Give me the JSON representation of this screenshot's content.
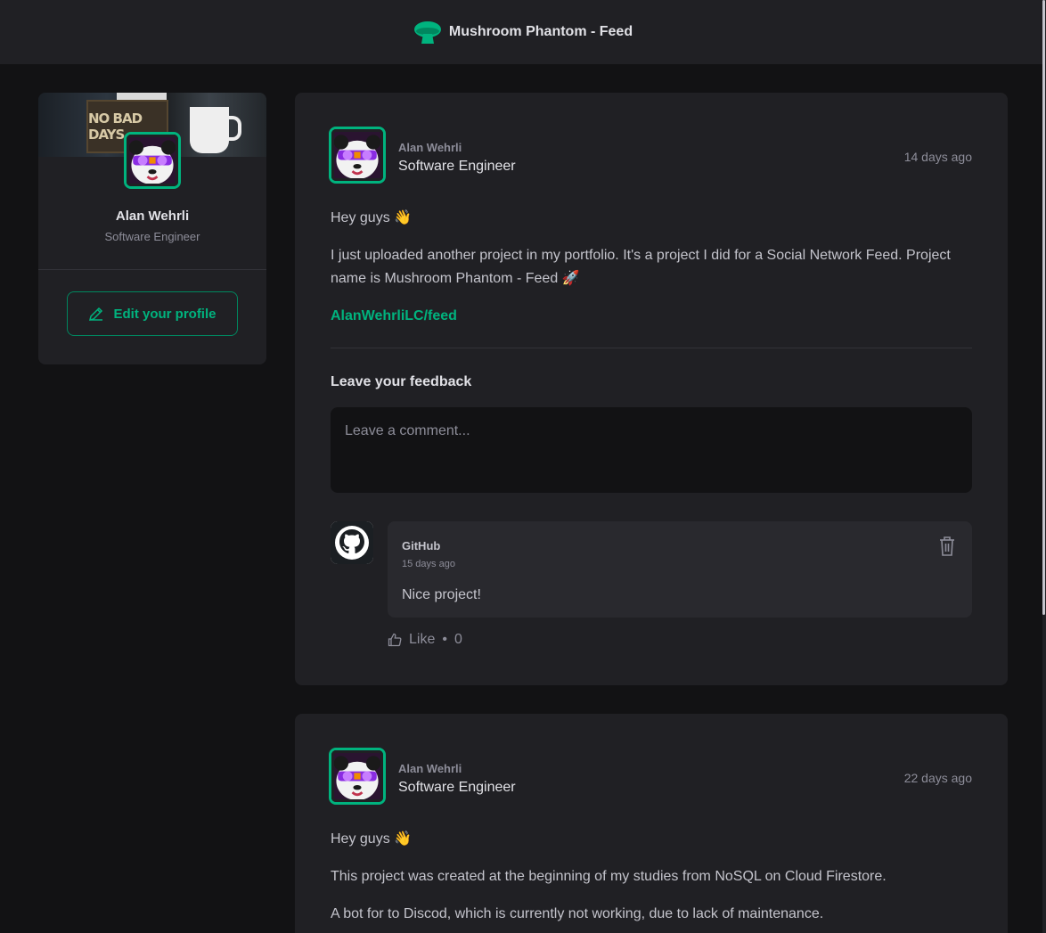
{
  "app": {
    "title": "Mushroom Phantom - Feed"
  },
  "profile": {
    "name": "Alan Wehrli",
    "role": "Software Engineer",
    "edit_label": "Edit your profile"
  },
  "posts": [
    {
      "author": "Alan Wehrli",
      "role": "Software Engineer",
      "time": "14 days ago",
      "greeting": "Hey guys 👋",
      "paragraph": "I just uploaded another project in my portfolio. It's a project I did for a Social Network Feed. Project name is Mushroom Phantom - Feed 🚀",
      "link": "AlanWehrliLC/feed",
      "feedback_title": "Leave your feedback",
      "comment_placeholder": "Leave a comment...",
      "comments": [
        {
          "author": "GitHub",
          "time": "15 days ago",
          "text": "Nice project!",
          "like_label": "Like",
          "like_separator": "•",
          "like_count": "0"
        }
      ]
    },
    {
      "author": "Alan Wehrli",
      "role": "Software Engineer",
      "time": "22 days ago",
      "greeting": "Hey guys 👋",
      "paragraph": "This project was created at the beginning of my studies from NoSQL on Cloud Firestore.",
      "paragraph2": "A bot for to Discod, which is currently not working, due to lack of maintenance."
    }
  ],
  "colors": {
    "accent": "#00b37e",
    "background": "#121214",
    "surface": "#202024"
  },
  "icons": [
    "mushroom-logo-icon",
    "pencil-icon",
    "trash-icon",
    "thumbs-up-icon",
    "github-icon"
  ]
}
